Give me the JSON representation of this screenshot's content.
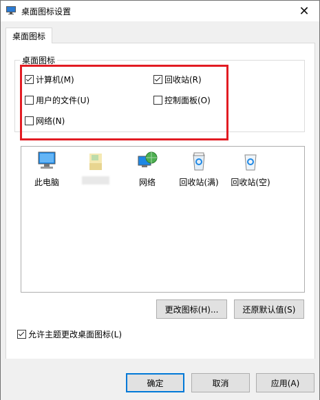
{
  "window": {
    "title": "桌面图标设置",
    "close_label": "✕"
  },
  "tab": {
    "label": "桌面图标"
  },
  "group": {
    "legend": "桌面图标",
    "checkboxes": [
      {
        "label": "计算机(M)",
        "checked": true
      },
      {
        "label": "回收站(R)",
        "checked": true
      },
      {
        "label": "用户的文件(U)",
        "checked": false
      },
      {
        "label": "控制面板(O)",
        "checked": false
      },
      {
        "label": "网络(N)",
        "checked": false
      }
    ]
  },
  "icons": [
    {
      "label": "此电脑",
      "icon": "computer-icon"
    },
    {
      "label": "",
      "icon": "user-folder-icon"
    },
    {
      "label": "网络",
      "icon": "network-icon"
    },
    {
      "label": "回收站(满)",
      "icon": "recycle-bin-full-icon"
    },
    {
      "label": "回收站(空)",
      "icon": "recycle-bin-empty-icon"
    }
  ],
  "buttons": {
    "change_icon": "更改图标(H)...",
    "restore_default": "还原默认值(S)",
    "ok": "确定",
    "cancel": "取消",
    "apply": "应用(A)"
  },
  "allow_themes": {
    "label": "允许主题更改桌面图标(L)",
    "checked": true
  },
  "colors": {
    "highlight": "#e21b22",
    "accent": "#0078d7"
  }
}
